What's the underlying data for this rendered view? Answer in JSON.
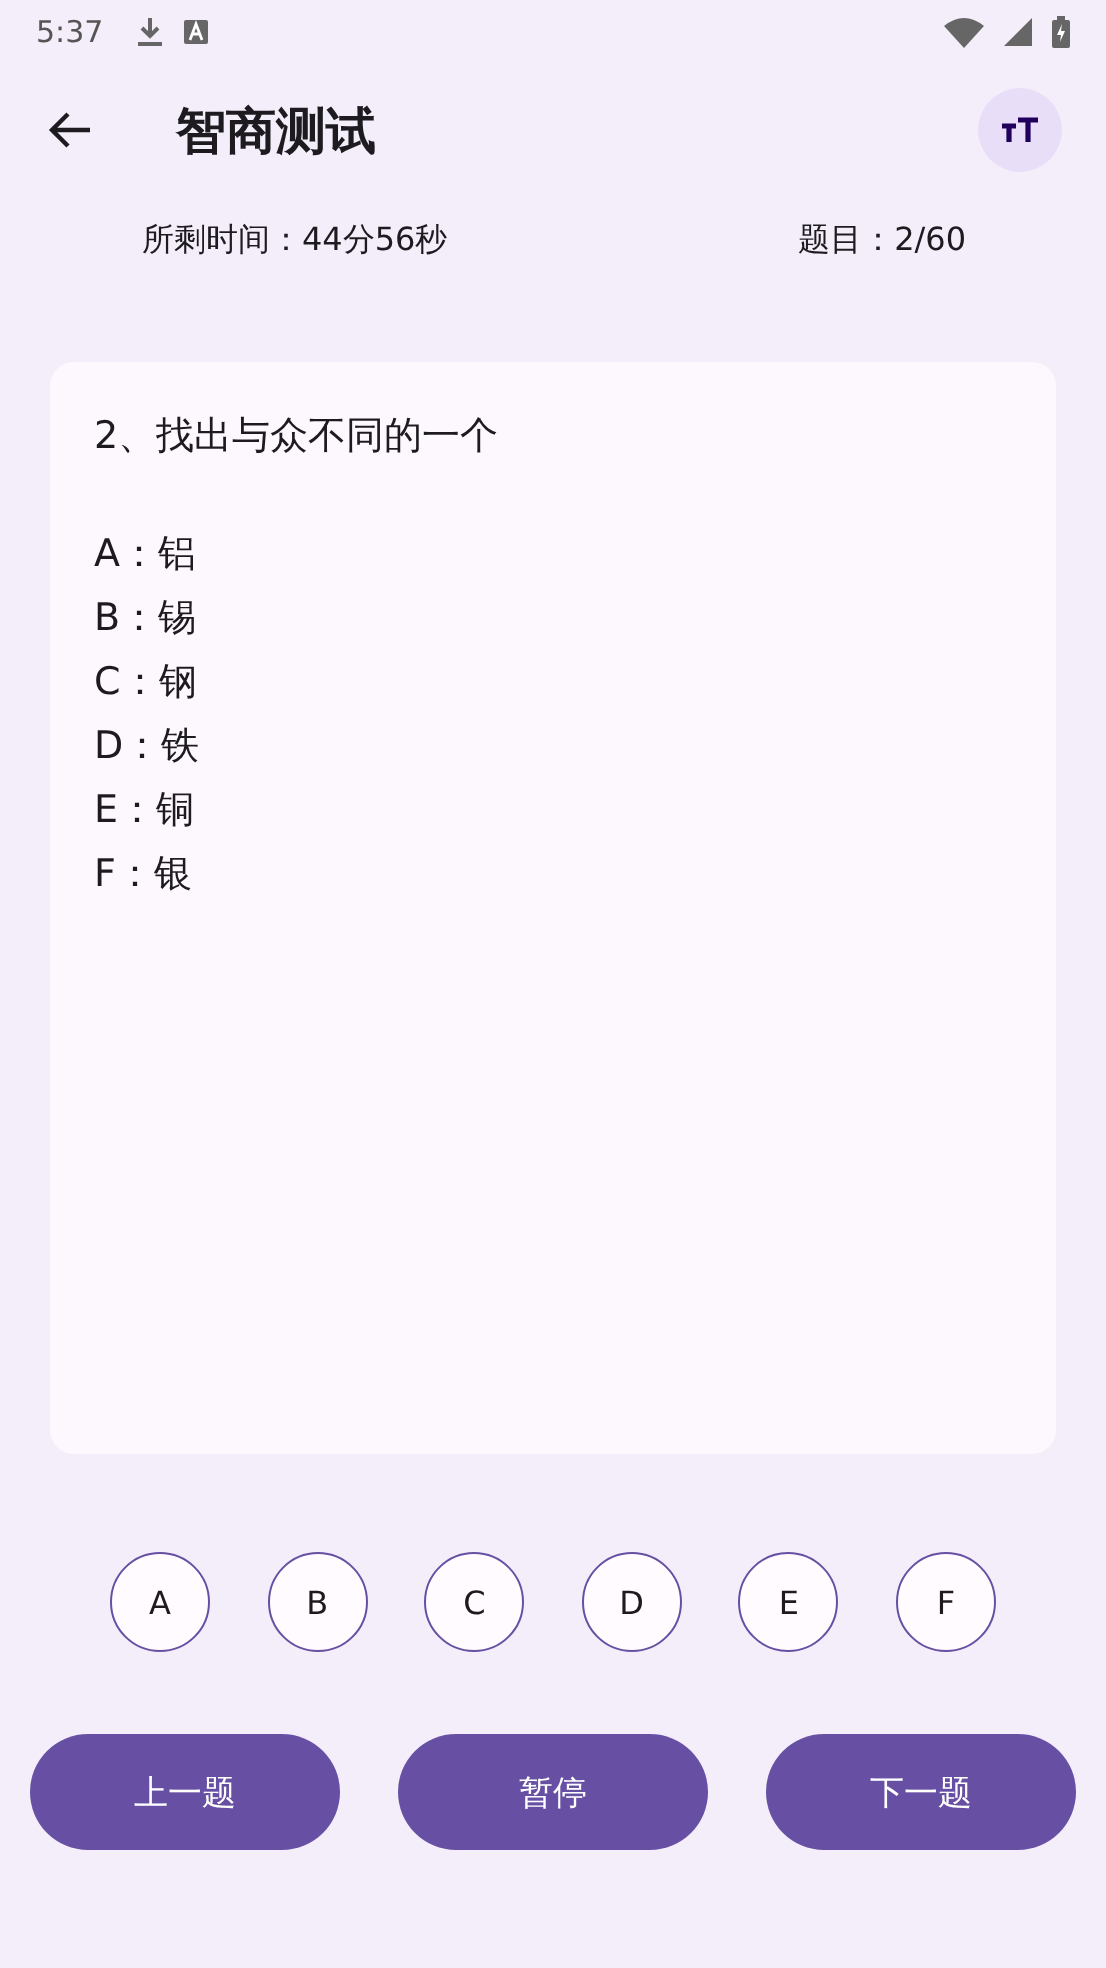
{
  "status_bar": {
    "time": "5:37"
  },
  "app_bar": {
    "title": "智商测试"
  },
  "info": {
    "time_left": "所剩时间：44分56秒",
    "progress": "题目：2/60"
  },
  "question": {
    "text": "2、找出与众不同的一个",
    "options": [
      "A：铝",
      "B：锡",
      "C：钢",
      "D：铁",
      "E：铜",
      "F：银"
    ]
  },
  "choices": [
    {
      "label": "A",
      "selected": false
    },
    {
      "label": "B",
      "selected": false
    },
    {
      "label": "C",
      "selected": false
    },
    {
      "label": "D",
      "selected": false
    },
    {
      "label": "E",
      "selected": false
    },
    {
      "label": "F",
      "selected": false
    }
  ],
  "buttons": [
    "上一题",
    "暂停",
    "下一题"
  ]
}
